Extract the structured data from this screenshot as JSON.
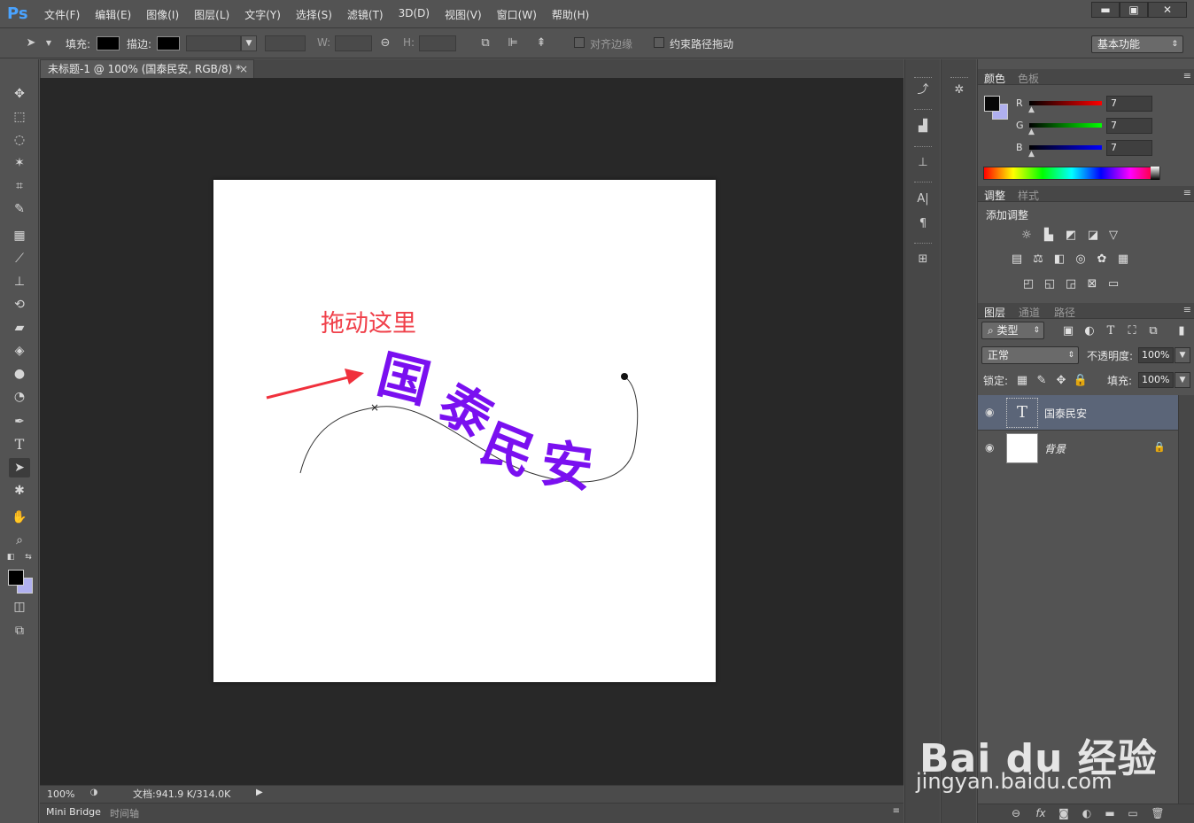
{
  "menubar": {
    "logo": "Ps",
    "items": [
      "文件(F)",
      "编辑(E)",
      "图像(I)",
      "图层(L)",
      "文字(Y)",
      "选择(S)",
      "滤镜(T)",
      "3D(D)",
      "视图(V)",
      "窗口(W)",
      "帮助(H)"
    ],
    "minimize": "▬",
    "maximize": "▣",
    "close": "✕"
  },
  "options": {
    "fill_label": "填充:",
    "stroke_label": "描边:",
    "w_label": "W:",
    "h_label": "H:",
    "align_edges": "对齐边缘",
    "constrain_path": "约束路径拖动",
    "workspace": "基本功能"
  },
  "document": {
    "tab_title": "未标题-1 @ 100% (国泰民安, RGB/8) *",
    "annotation": "拖动这里",
    "text_on_path": [
      "国",
      "泰",
      "民",
      "安"
    ],
    "text_color": "#7a10f0",
    "annotation_color": "#f0404a"
  },
  "status": {
    "zoom": "100%",
    "doc_size": "文档:941.9 K/314.0K"
  },
  "bottom_tabs": [
    "Mini Bridge",
    "时间轴"
  ],
  "color_panel": {
    "tabs": [
      "颜色",
      "色板"
    ],
    "channels": [
      {
        "label": "R",
        "value": "7",
        "bar": "#ff0000"
      },
      {
        "label": "G",
        "value": "7",
        "bar": "#00ff00"
      },
      {
        "label": "B",
        "value": "7",
        "bar": "#0000ff"
      }
    ],
    "foreground": "#070707",
    "background": "#b0b0ef"
  },
  "adjust_panel": {
    "tabs": [
      "调整",
      "样式"
    ],
    "title": "添加调整"
  },
  "layers_panel": {
    "tabs": [
      "图层",
      "通道",
      "路径"
    ],
    "filter_kind": "类型",
    "blend_mode": "正常",
    "opacity_label": "不透明度:",
    "opacity": "100%",
    "lock_label": "锁定:",
    "fill_label": "填充:",
    "fill": "100%",
    "layers": [
      {
        "name": "国泰民安",
        "type": "text",
        "thumb": "T",
        "selected": true
      },
      {
        "name": "背景",
        "type": "background",
        "locked": true
      }
    ]
  },
  "watermark": {
    "brand": "Bai du 经验",
    "url": "jingyan.baidu.com"
  }
}
